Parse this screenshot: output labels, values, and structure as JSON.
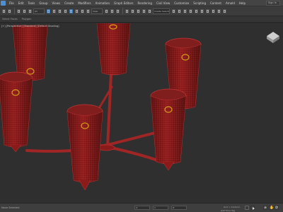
{
  "menubar": {
    "items": [
      "File",
      "Edit",
      "Tools",
      "Group",
      "Views",
      "Create",
      "Modifiers",
      "Animation",
      "Graph Editors",
      "Rendering",
      "Civil View",
      "Customize",
      "Scripting",
      "Content",
      "Arnold",
      "Help"
    ],
    "search_text": "Sign In"
  },
  "toolbar": {
    "filter_dropdown": "All",
    "view_dropdown": "View",
    "selection_set": "Create Selection Se"
  },
  "ribbon": {
    "tabs": [
      "Select Faces",
      "Polygon"
    ]
  },
  "viewport": {
    "label": "[+] [Perspective] [Standard] [Default Shading]",
    "object_color": "#8b1a1a",
    "mesh_color": "#c43535",
    "accent_color": "#d4a017"
  },
  "statusbar": {
    "status_text": "None Selected",
    "x_label": "X:",
    "y_label": "Y:",
    "z_label": "Z:",
    "grid": "Grid = 10,0mm",
    "add_time_tag": "Add Time Tag"
  }
}
